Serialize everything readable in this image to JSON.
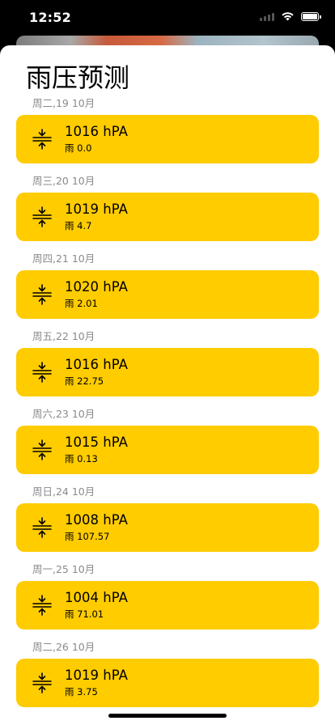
{
  "status": {
    "time": "12:52"
  },
  "page": {
    "title": "雨压预测"
  },
  "forecast": [
    {
      "date": "周二,19 10月",
      "pressure": "1016 hPA",
      "rain": "雨 0.0"
    },
    {
      "date": "周三,20 10月",
      "pressure": "1019 hPA",
      "rain": "雨 4.7"
    },
    {
      "date": "周四,21 10月",
      "pressure": "1020 hPA",
      "rain": "雨 2.01"
    },
    {
      "date": "周五,22 10月",
      "pressure": "1016 hPA",
      "rain": "雨 22.75"
    },
    {
      "date": "周六,23 10月",
      "pressure": "1015 hPA",
      "rain": "雨 0.13"
    },
    {
      "date": "周日,24 10月",
      "pressure": "1008 hPA",
      "rain": "雨 107.57"
    },
    {
      "date": "周一,25 10月",
      "pressure": "1004 hPA",
      "rain": "雨 71.01"
    },
    {
      "date": "周二,26 10月",
      "pressure": "1019 hPA",
      "rain": "雨 3.75"
    }
  ],
  "colors": {
    "card": "#ffcc00",
    "date_text": "#8a8a8e",
    "background": "#ffffff"
  },
  "icons": {
    "card_icon": "pressure-compress-icon"
  }
}
